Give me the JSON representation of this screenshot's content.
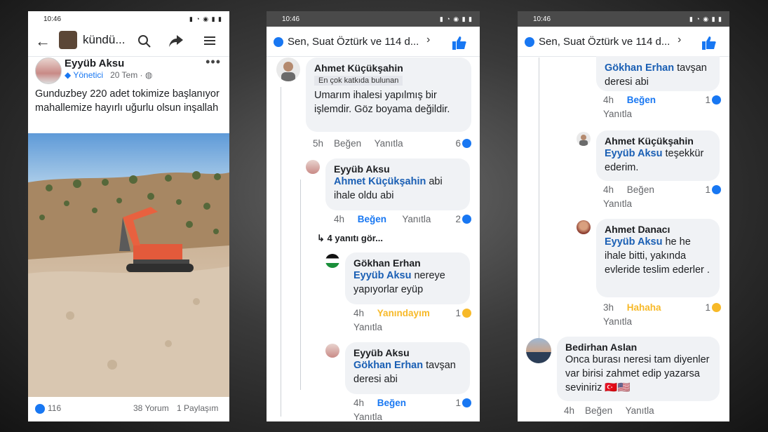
{
  "status": {
    "time": "10:46"
  },
  "panel1": {
    "page_name": "kündü...",
    "poster": {
      "name": "Eyyüb Aksu",
      "role": "Yönetici",
      "time": "20 Tem"
    },
    "post_text": "Gunduzbey 220 adet tokimize başlanıyor mahallemize hayırlı uğurlu olsun inşallah",
    "footer": {
      "likes": "116",
      "comments": "38 Yorum",
      "shares": "1 Paylaşım"
    }
  },
  "panel2": {
    "header": "Sen, Suat Öztürk ve 114 d...",
    "c1": {
      "name": "Ahmet Küçükşahin",
      "badge": "En çok katkıda bulunan",
      "text": "Umarım ihalesi yapılmış bir işlemdir. Göz boyama değildir.",
      "time": "5h",
      "like": "Beğen",
      "reply": "Yanıtla",
      "count": "6"
    },
    "c2": {
      "name": "Eyyüb Aksu",
      "mention": "Ahmet Küçükşahin",
      "text": " abi ihale oldu abi",
      "time": "4h",
      "like": "Beğen",
      "reply": "Yanıtla",
      "count": "2"
    },
    "more_replies": "4 yanıtı gör...",
    "c3": {
      "name": "Gökhan Erhan",
      "mention": "Eyyüb Aksu",
      "text": " nereye yapıyorlar eyüp",
      "time": "4h",
      "like": "Yanındayım",
      "reply": "Yanıtla",
      "count": "1"
    },
    "c4": {
      "name": "Eyyüb Aksu",
      "mention": "Gökhan Erhan",
      "text": " tavşan deresi abi",
      "time": "4h",
      "like": "Beğen",
      "reply": "Yanıtla",
      "count": "1"
    }
  },
  "panel3": {
    "header": "Sen, Suat Öztürk ve 114 d...",
    "c1": {
      "mention": "Gökhan Erhan",
      "text": " tavşan deresi abi",
      "time": "4h",
      "like": "Beğen",
      "reply": "Yanıtla",
      "count": "1"
    },
    "c2": {
      "name": "Ahmet Küçükşahin",
      "mention": "Eyyüb Aksu",
      "text": " teşekkür ederim.",
      "time": "4h",
      "like": "Beğen",
      "reply": "Yanıtla",
      "count": "1"
    },
    "c3": {
      "name": "Ahmet Danacı",
      "mention": "Eyyüb Aksu",
      "text": " he he ihale bitti, yakında evleride teslim ederler .",
      "time": "3h",
      "like": "Hahaha",
      "reply": "Yanıtla",
      "count": "1"
    },
    "c4": {
      "name": "Bedirhan Aslan",
      "text": "Onca burası neresi tam diyenler var birisi zahmet edip yazarsa seviniriz 🇹🇷🇺🇸",
      "time": "4h",
      "like": "Beğen",
      "reply": "Yanıtla"
    }
  },
  "colors": {
    "accent": "#1877f2",
    "bubble": "#f0f2f5",
    "haha": "#f7b928"
  }
}
